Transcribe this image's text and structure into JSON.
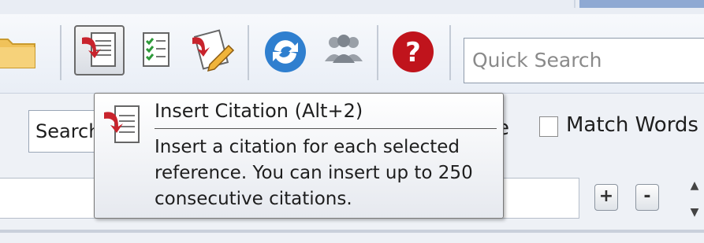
{
  "toolbar": {
    "buttons": [
      {
        "icon": "folder-icon"
      },
      {
        "icon": "insert-citation-icon",
        "pressed": true
      },
      {
        "icon": "format-bibliography-icon"
      },
      {
        "icon": "edit-citation-icon"
      },
      {
        "icon": "sync-icon"
      },
      {
        "icon": "groups-icon"
      },
      {
        "icon": "help-icon"
      }
    ],
    "search_placeholder": "Quick Search"
  },
  "search_panel": {
    "field_value": "Search",
    "partial_text": "e",
    "match_words_label": "Match Words",
    "match_words_checked": false,
    "plus_label": "+",
    "minus_label": "-"
  },
  "tooltip": {
    "title": "Insert Citation (Alt+2)",
    "lines": [
      "Insert a citation for each selected",
      "reference. You can insert up to 250",
      "consecutive citations."
    ]
  },
  "colors": {
    "accent_red": "#c8232c",
    "sync_blue": "#2f7fcf",
    "help_red": "#c0141c"
  }
}
